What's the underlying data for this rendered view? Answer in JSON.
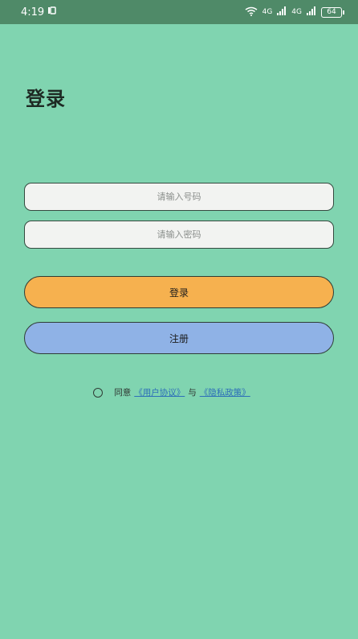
{
  "status_bar": {
    "time": "4:19",
    "network_1": "4G",
    "network_2": "4G",
    "battery": "64"
  },
  "page": {
    "title": "登录"
  },
  "form": {
    "phone_placeholder": "请输入号码",
    "password_placeholder": "请输入密码",
    "login_label": "登录",
    "register_label": "注册"
  },
  "agreement": {
    "prefix": "同意",
    "user_agreement": "《用户协议》",
    "connector": "与",
    "privacy_policy": "《隐私政策》"
  },
  "colors": {
    "background": "#80d4b0",
    "status_bar": "#4f8a68",
    "login_button": "#f6b14f",
    "register_button": "#8fb2e6",
    "link": "#2d6fb9"
  }
}
